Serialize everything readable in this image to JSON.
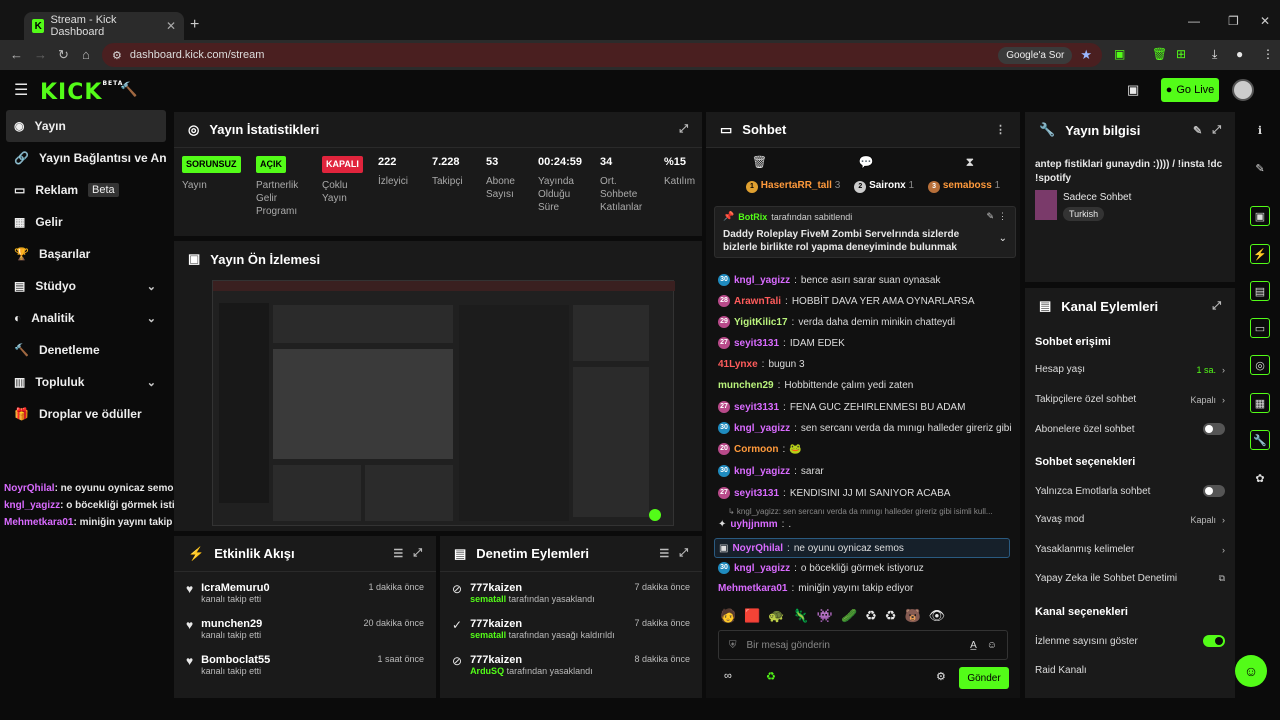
{
  "browser": {
    "tab_title": "Stream - Kick Dashboard",
    "url": "dashboard.kick.com/stream",
    "google_btn": "Google'a Sor"
  },
  "header": {
    "logo": "KICK",
    "logo_beta": "BETA",
    "go_live": "Go Live"
  },
  "sidebar": {
    "items": [
      {
        "label": "Yayın",
        "icon": "broadcast-icon"
      },
      {
        "label": "Yayın Bağlantısı ve Anahtarı",
        "icon": "link-icon"
      },
      {
        "label": "Reklam",
        "icon": "ad-icon",
        "badge": "Beta"
      },
      {
        "label": "Gelir",
        "icon": "income-icon"
      },
      {
        "label": "Başarılar",
        "icon": "trophy-icon"
      },
      {
        "label": "Stüdyo",
        "icon": "studio-icon"
      },
      {
        "label": "Analitik",
        "icon": "chart-icon"
      },
      {
        "label": "Denetleme",
        "icon": "hammer-icon"
      },
      {
        "label": "Topluluk",
        "icon": "community-icon"
      },
      {
        "label": "Droplar ve ödüller",
        "icon": "gift-icon"
      }
    ]
  },
  "overlay_chat": [
    {
      "user": "NoyrQhilal",
      "text": ": ne oyunu oynicaz semos",
      "color": "#d96bff"
    },
    {
      "user": "kngl_yagizz",
      "text": ": o böcekliği görmek istiyoruz",
      "color": "#d96bff"
    },
    {
      "user": "Mehmetkara01",
      "text": ": miniğin yayını takip ediyor",
      "color": "#d96bff"
    }
  ],
  "stats": {
    "title": "Yayın İstatistikleri",
    "items": [
      {
        "badge": "SORUNSUZ",
        "label": "Yayın",
        "color": "#53fc18"
      },
      {
        "badge": "AÇIK",
        "label": "Partnerlik Gelir Programı",
        "color": "#53fc18"
      },
      {
        "badge": "KAPALI",
        "label": "Çoklu Yayın",
        "color": "#e0243c"
      },
      {
        "value": "222",
        "label": "İzleyici"
      },
      {
        "value": "7.228",
        "label": "Takipçi"
      },
      {
        "value": "53",
        "label": "Abone Sayısı"
      },
      {
        "value": "00:24:59",
        "label": "Yayında Olduğu Süre"
      },
      {
        "value": "34",
        "label": "Ort. Sohbete Katılanlar"
      },
      {
        "value": "%15",
        "label": "Katılım"
      }
    ]
  },
  "preview": {
    "title": "Yayın Ön İzlemesi"
  },
  "activity": {
    "title": "Etkinlik Akışı",
    "rows": [
      {
        "name": "IcraMemuru0",
        "sub": "kanalı takip etti",
        "time": "1 dakika önce"
      },
      {
        "name": "munchen29",
        "sub": "kanalı takip etti",
        "time": "20 dakika önce"
      },
      {
        "name": "Bomboclat55",
        "sub": "kanalı takip etti",
        "time": "1 saat önce"
      }
    ]
  },
  "moderation": {
    "title": "Denetim Eylemleri",
    "rows": [
      {
        "name": "777kaizen",
        "mod": "sematall",
        "sub": "tarafından yasaklandı",
        "time": "7 dakika önce"
      },
      {
        "name": "777kaizen",
        "mod": "sematall",
        "sub": "tarafından yasağı kaldırıldı",
        "time": "7 dakika önce"
      },
      {
        "name": "777kaizen",
        "mod": "ArduSQ",
        "sub": "tarafından yasaklandı",
        "time": "8 dakika önce"
      }
    ]
  },
  "chat": {
    "title": "Sohbet",
    "top": [
      {
        "rank": "1",
        "name": "HasertaRR_tall",
        "n": "3"
      },
      {
        "rank": "2",
        "name": "Saironx",
        "n": "1"
      },
      {
        "rank": "3",
        "name": "semaboss",
        "n": "1"
      }
    ],
    "pinned_by": "BotRix",
    "pinned_suffix": "tarafından sabitlendi",
    "pinned_text": "Daddy Roleplay FiveM Zombi Servelrında sizlerde bizlerle birlikte rol yapma deneyiminde bulunmak istiyorsanız fırsa...",
    "messages": [
      {
        "user": "kngl_yagizz",
        "text": "bence asırı sarar suan oynasak",
        "color": "#d96bff",
        "badge": "30",
        "bc": "#1f8bbf"
      },
      {
        "user": "ArawnTali",
        "text": "HOBBİT DAVA YER AMA OYNARLARSA",
        "color": "#ff5c5c",
        "badge": "28",
        "bc": "#b84a8a"
      },
      {
        "user": "YigitKilic17",
        "text": "verda daha demin minikin chatteydi",
        "color": "#b9f27c",
        "badge": "29",
        "bc": "#b84a8a"
      },
      {
        "user": "seyit3131",
        "text": "IDAM EDEK",
        "color": "#d96bff",
        "badge": "27",
        "bc": "#b84a8a"
      },
      {
        "user": "41Lynxe",
        "text": "bugun 3",
        "color": "#ff5c5c"
      },
      {
        "user": "munchen29",
        "text": "Hobbittende çalım yedi zaten",
        "color": "#b9f27c"
      },
      {
        "user": "seyit3131",
        "text": "FENA GUC ZEHIRLENMESI BU ADAM",
        "color": "#d96bff",
        "badge": "27",
        "bc": "#b84a8a"
      },
      {
        "user": "kngl_yagizz",
        "text": "sen sercanı verda da mınıgı halleder gireriz gibi",
        "color": "#d96bff",
        "badge": "30",
        "bc": "#1f8bbf"
      },
      {
        "user": "Cormoon",
        "text": "🐸",
        "color": "#ff9a3c",
        "badge": "20",
        "bc": "#b84a8a"
      },
      {
        "user": "kngl_yagizz",
        "text": "sarar",
        "color": "#d96bff",
        "badge": "30",
        "bc": "#1f8bbf"
      },
      {
        "user": "seyit3131",
        "text": "KENDISINI JJ MI SANIYOR ACABA",
        "color": "#d96bff",
        "badge": "27",
        "bc": "#b84a8a"
      },
      {
        "user": "uyhjjnmm",
        "text": ".",
        "color": "#d96bff"
      },
      {
        "user": "NoyrQhilal",
        "text": "ne oyunu oynicaz semos",
        "color": "#d96bff"
      },
      {
        "user": "kngl_yagizz",
        "text": "o böcekliği görmek istiyoruz",
        "color": "#d96bff",
        "badge": "30",
        "bc": "#1f8bbf"
      },
      {
        "user": "Mehmetkara01",
        "text": "miniğin yayını takip ediyor",
        "color": "#d96bff"
      }
    ],
    "reply_hint": "↳ kngl_yagizz: sen sercanı verda da mınıgı halleder gireriz gibi isimli kull...",
    "placeholder": "Bir mesaj gönderin",
    "send": "Gönder"
  },
  "info": {
    "title": "Yayın bilgisi",
    "stream_title": "antep fistiklari gunaydin :)))) / !insta !dc !spotify",
    "category": "Sadece Sohbet",
    "language": "Turkish"
  },
  "channel": {
    "title": "Kanal Eylemleri",
    "h_access": "Sohbet erişimi",
    "account_age": "Hesap yaşı",
    "account_age_val": "1 sa.",
    "followers_only": "Takipçilere özel sohbet",
    "followers_only_val": "Kapalı",
    "subs_only": "Abonelere özel sohbet",
    "h_options": "Sohbet seçenekleri",
    "emotes_only": "Yalnızca Emotlarla sohbet",
    "slow_mode": "Yavaş mod",
    "slow_mode_val": "Kapalı",
    "banned_words": "Yasaklanmış kelimeler",
    "ai_mod": "Yapay Zeka ile Sohbet Denetimi",
    "h_channel": "Kanal seçenekleri",
    "show_viewers": "İzlenme sayısını göster",
    "raid": "Raid Kanalı"
  }
}
